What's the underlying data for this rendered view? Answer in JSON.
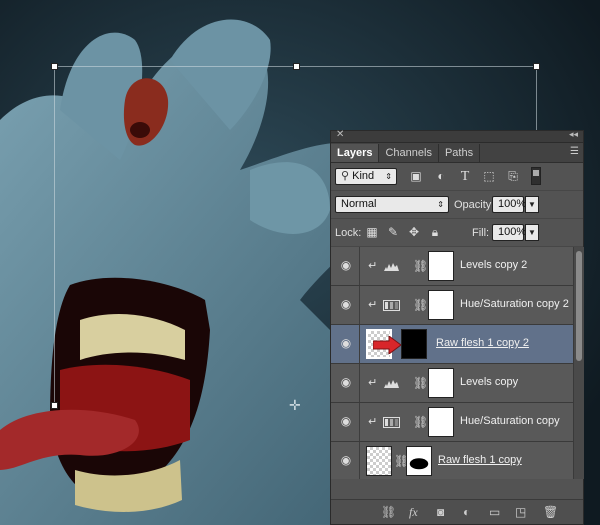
{
  "panel": {
    "tabs": [
      {
        "label": "Layers"
      },
      {
        "label": "Channels"
      },
      {
        "label": "Paths"
      }
    ],
    "filter": {
      "kind_label": "Kind"
    },
    "blend_mode": "Normal",
    "opacity_label": "Opacity:",
    "opacity_value": "100%",
    "lock_label": "Lock:",
    "fill_label": "Fill:",
    "fill_value": "100%",
    "layers": [
      {
        "name": "Levels copy 2",
        "type": "levels"
      },
      {
        "name": "Hue/Saturation copy 2",
        "type": "huesat"
      },
      {
        "name": "Raw flesh 1 copy 2",
        "type": "pixel",
        "selected": true
      },
      {
        "name": "Levels copy",
        "type": "levels"
      },
      {
        "name": "Hue/Saturation copy",
        "type": "huesat"
      },
      {
        "name": "Raw flesh 1 copy",
        "type": "pixel"
      }
    ]
  },
  "colors": {
    "canvas_bg": "#1b2a33",
    "skin": "#5b8193",
    "panel_bg": "#535353",
    "selected_row": "#61718a",
    "arrow": "#d8262a"
  }
}
